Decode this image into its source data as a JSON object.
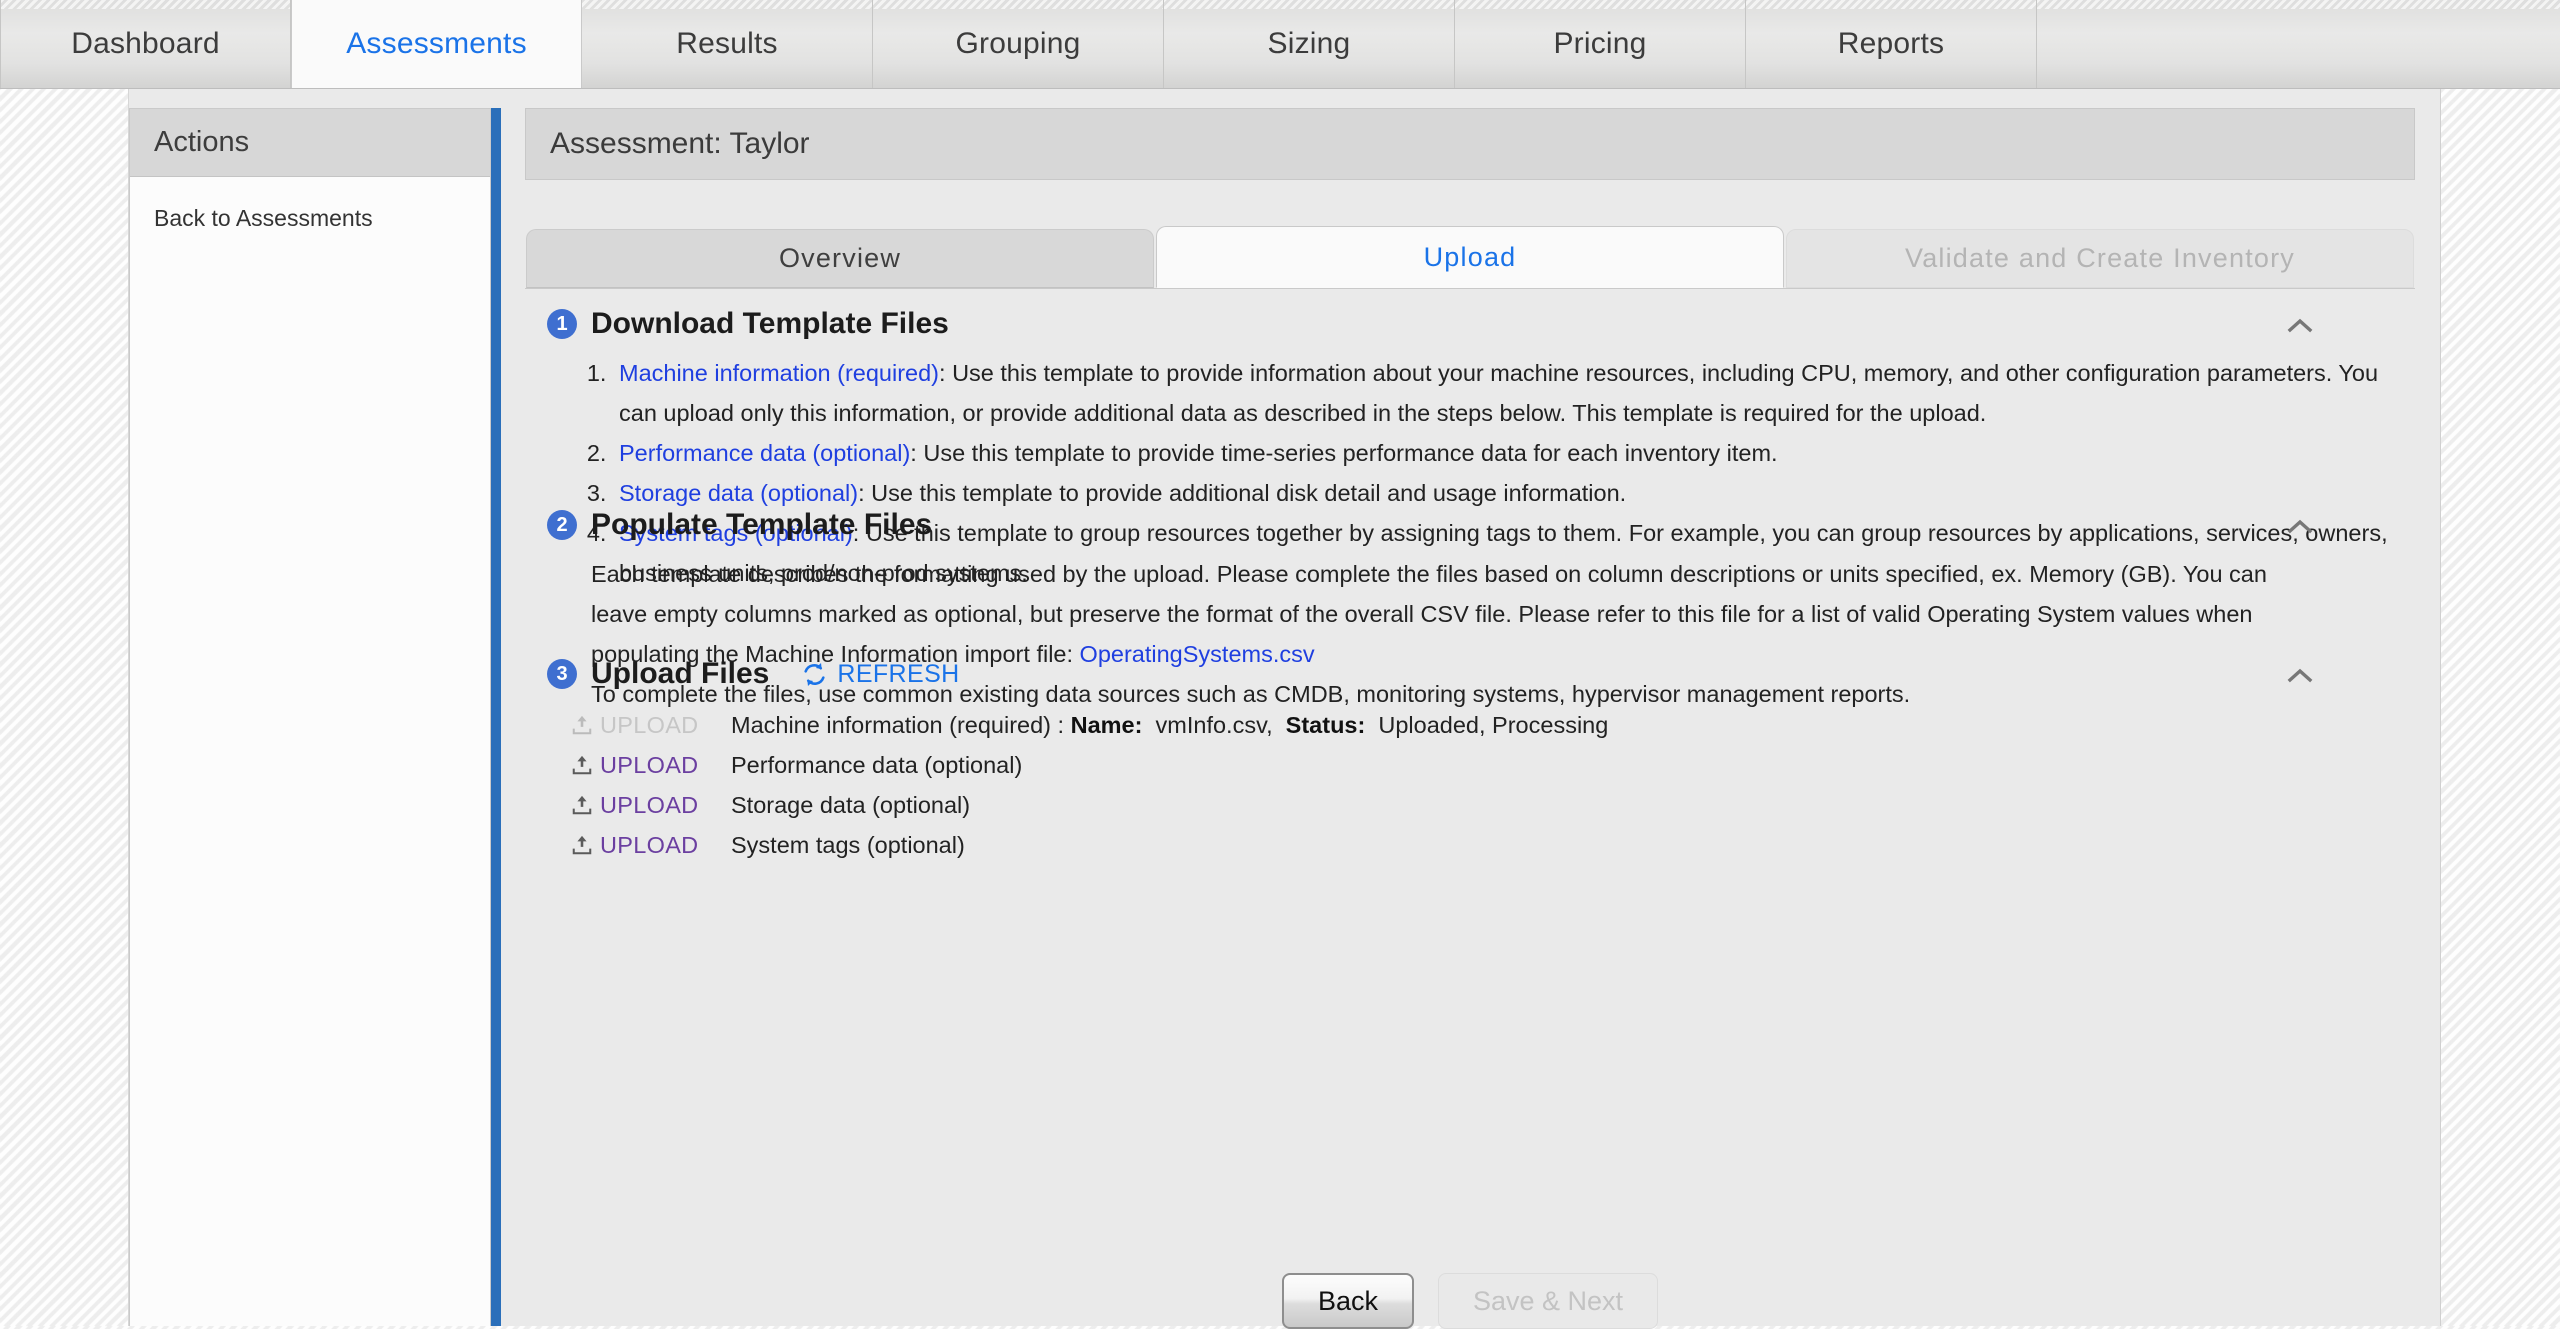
{
  "topnav": {
    "tabs": [
      {
        "label": "Dashboard",
        "active": false
      },
      {
        "label": "Assessments",
        "active": true
      },
      {
        "label": "Results",
        "active": false
      },
      {
        "label": "Grouping",
        "active": false
      },
      {
        "label": "Sizing",
        "active": false
      },
      {
        "label": "Pricing",
        "active": false
      },
      {
        "label": "Reports",
        "active": false
      }
    ]
  },
  "sidebar": {
    "header": "Actions",
    "items": [
      {
        "label": "Back to Assessments"
      }
    ]
  },
  "main": {
    "assessment_title": "Assessment: Taylor",
    "steptabs": [
      {
        "label": "Overview",
        "state": "inactive"
      },
      {
        "label": "Upload",
        "state": "current"
      },
      {
        "label": "Validate and Create Inventory",
        "state": "disabled"
      }
    ]
  },
  "section1": {
    "number": "1",
    "title": "Download Template Files",
    "collapse_icon": "chevron-up-icon",
    "items": [
      {
        "link": "Machine information (required)",
        "text": ": Use this template to provide information about your machine resources, including CPU, memory, and other configuration parameters. You can upload only this information, or provide additional data as described in the steps below. This template is required for the upload."
      },
      {
        "link": "Performance data (optional)",
        "text": ": Use this template to provide time-series performance data for each inventory item."
      },
      {
        "link": "Storage data (optional)",
        "text": ": Use this template to provide additional disk detail and usage information."
      },
      {
        "link": "System tags (optional)",
        "text": ": Use this template to group resources together by assigning tags to them. For example, you can group resources by applications, services, owners, business units, prod/non-prod systems."
      }
    ]
  },
  "section2": {
    "number": "2",
    "title": "Populate Template Files",
    "collapse_icon": "chevron-up-icon",
    "paragraph1_before_link": "Each template describes the formatting used by the upload. Please complete the files based on column descriptions or units specified, ex. Memory (GB). You can leave empty columns marked as optional, but preserve the format of the overall CSV file. Please refer to this file for a list of valid Operating System values when populating the Machine Information import file: ",
    "paragraph1_link": "OperatingSystems.csv",
    "paragraph2": "To complete the files, use common existing data sources such as CMDB, monitoring systems, hypervisor management reports."
  },
  "section3": {
    "number": "3",
    "title": "Upload Files",
    "collapse_icon": "chevron-up-icon",
    "refresh_label": "REFRESH",
    "refresh_icon": "refresh-icon",
    "rows": [
      {
        "upload_label": "UPLOAD",
        "upload_icon": "upload-icon",
        "disabled": true,
        "name": "Machine information (required)",
        "separator": " : ",
        "name_label": "Name:",
        "file_name": "vmInfo.csv,",
        "status_label": "Status:",
        "status_value": "Uploaded, Processing"
      },
      {
        "upload_label": "UPLOAD",
        "upload_icon": "upload-icon",
        "disabled": false,
        "name": "Performance data (optional)"
      },
      {
        "upload_label": "UPLOAD",
        "upload_icon": "upload-icon",
        "disabled": false,
        "name": "Storage data (optional)"
      },
      {
        "upload_label": "UPLOAD",
        "upload_icon": "upload-icon",
        "disabled": false,
        "name": "System tags (optional)"
      }
    ]
  },
  "footer": {
    "back_label": "Back",
    "save_next_label": "Save & Next"
  },
  "colors": {
    "accent_blue": "#1a73e8",
    "link_blue": "#1f3fe0",
    "badge_blue": "#3f6fd0",
    "divider_blue": "#2a6fba",
    "upload_purple": "#6b3fa0"
  }
}
